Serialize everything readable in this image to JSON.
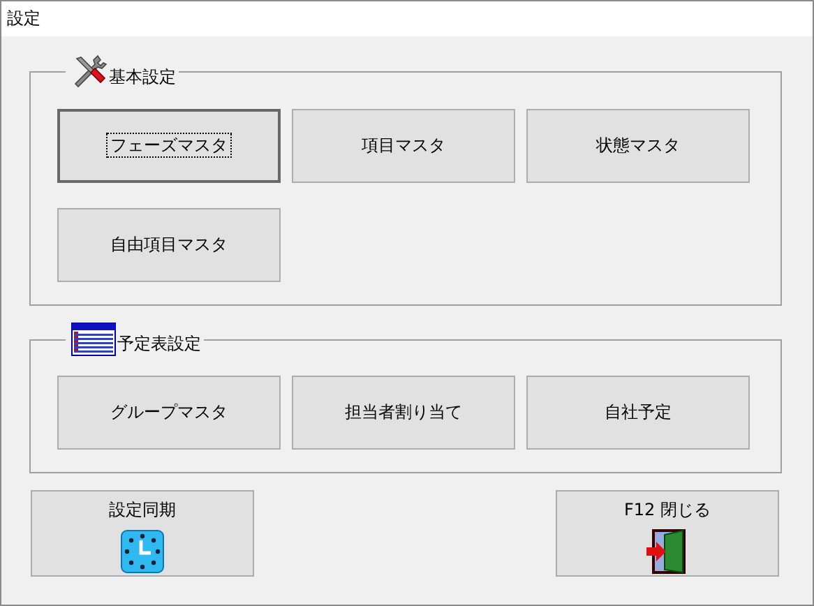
{
  "window": {
    "title": "設定"
  },
  "groups": [
    {
      "title": "基本設定",
      "buttons": [
        {
          "label": "フェーズマスタ",
          "focused": true
        },
        {
          "label": "項目マスタ",
          "focused": false
        },
        {
          "label": "状態マスタ",
          "focused": false
        },
        {
          "label": "自由項目マスタ",
          "focused": false
        }
      ]
    },
    {
      "title": "予定表設定",
      "buttons": [
        {
          "label": "グループマスタ",
          "focused": false
        },
        {
          "label": "担当者割り当て",
          "focused": false
        },
        {
          "label": "自社予定",
          "focused": false
        }
      ]
    }
  ],
  "bottom_buttons": [
    {
      "label": "設定同期"
    },
    {
      "label": "F12 閉じる"
    }
  ]
}
